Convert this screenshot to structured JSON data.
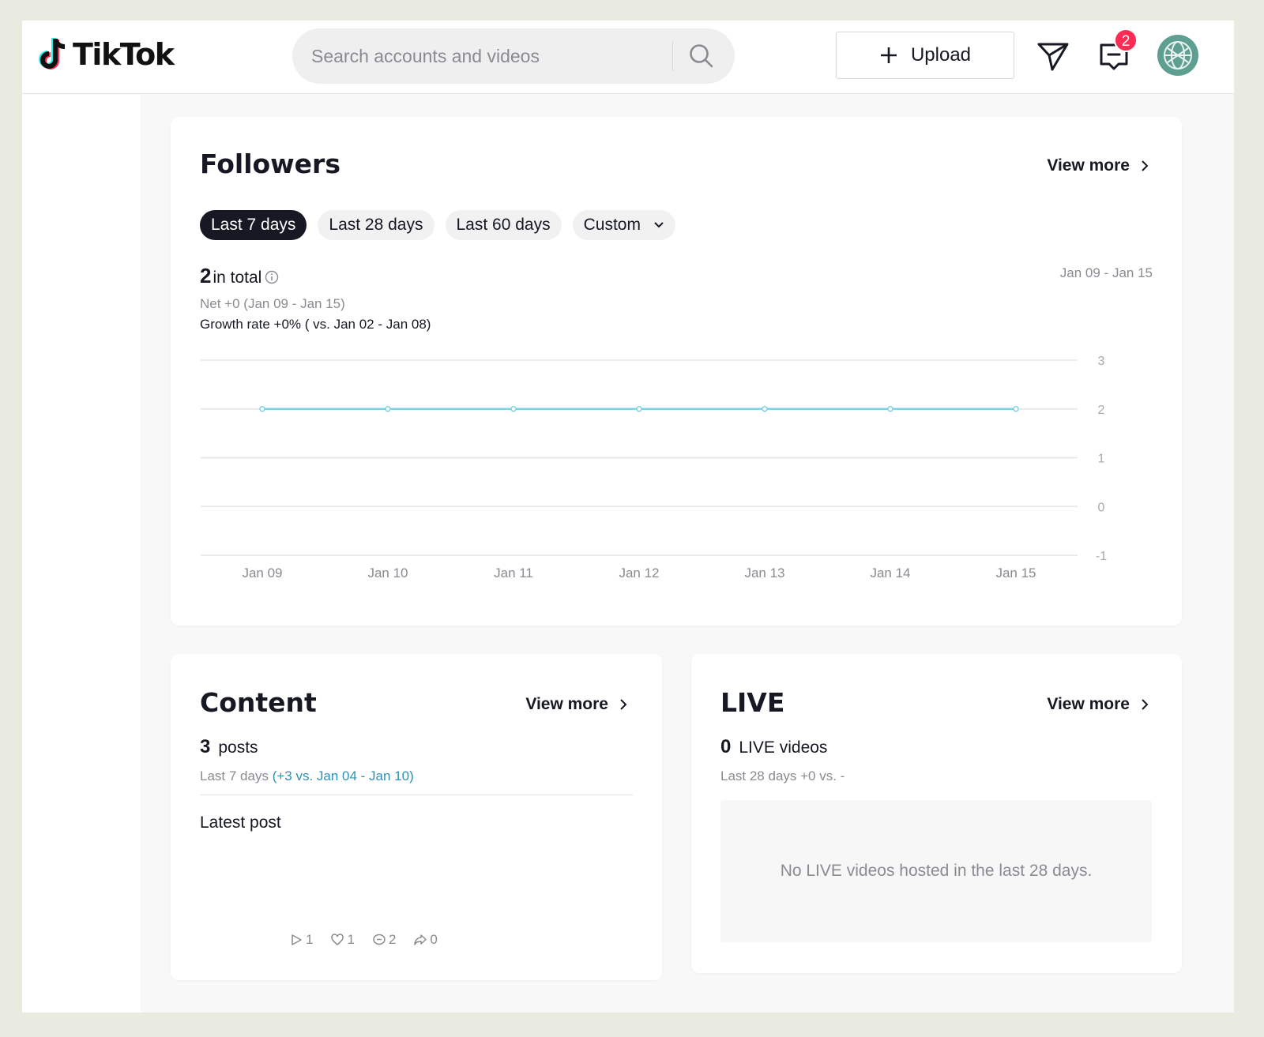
{
  "header": {
    "logo_text": "TikTok",
    "search": {
      "placeholder": "Search accounts and videos"
    },
    "upload_label": "Upload",
    "inbox_badge": "2"
  },
  "followers": {
    "title": "Followers",
    "view_more": "View more",
    "ranges": [
      "Last 7 days",
      "Last 28 days",
      "Last 60 days",
      "Custom"
    ],
    "active_range": "Last 7 days",
    "total_value": "2",
    "total_label": "in total",
    "date_range": "Jan 09 - Jan 15",
    "net": "Net +0 (Jan 09 - Jan 15)",
    "growth": "Growth rate +0% ( vs. Jan 02 - Jan 08)"
  },
  "chart_data": {
    "type": "line",
    "x": [
      "Jan 09",
      "Jan 10",
      "Jan 11",
      "Jan 12",
      "Jan 13",
      "Jan 14",
      "Jan 15"
    ],
    "series": [
      {
        "values": [
          2,
          2,
          2,
          2,
          2,
          2,
          2
        ]
      }
    ],
    "yticks": [
      3,
      2,
      1,
      0,
      -1
    ],
    "ylim": [
      -1,
      3
    ],
    "grid": true,
    "line_color": "#7ed3e3"
  },
  "content": {
    "title": "Content",
    "view_more": "View more",
    "posts_value": "3",
    "posts_label": "posts",
    "period": "Last 7 days",
    "comparison": "(+3 vs. Jan 04 - Jan 10)",
    "latest_post_label": "Latest post",
    "metrics": {
      "plays": "1",
      "likes": "1",
      "comments": "2",
      "shares": "0"
    }
  },
  "live": {
    "title": "LIVE",
    "view_more": "View more",
    "videos_value": "0",
    "videos_label": "LIVE videos",
    "period": "Last 28 days +0 vs. -",
    "empty_message": "No LIVE videos hosted in the last 28 days."
  },
  "colors": {
    "accent": "#fe2c55",
    "chart_line": "#7ed3e3",
    "link": "#2c92b5",
    "avatar": "#5e9f92"
  }
}
